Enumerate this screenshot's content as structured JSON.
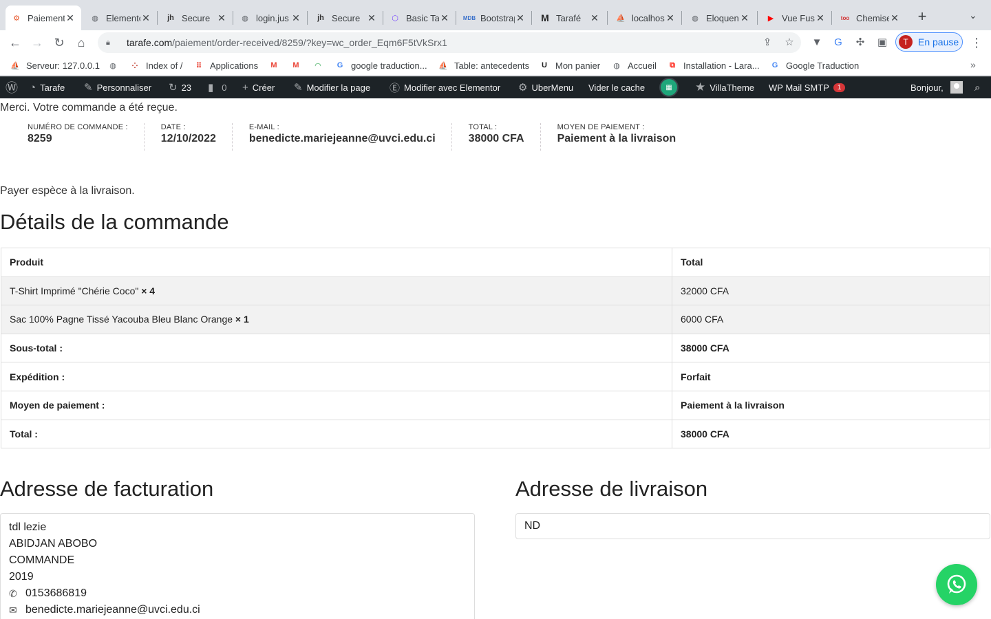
{
  "browser": {
    "tabs": [
      {
        "title": "Paiement",
        "favicon": "woocommerce-icon",
        "active": true
      },
      {
        "title": "Elementor",
        "favicon": "globe-icon",
        "active": false
      },
      {
        "title": "Secure",
        "favicon": "jh-icon",
        "active": false
      },
      {
        "title": "login.jus",
        "favicon": "globe-icon",
        "active": false
      },
      {
        "title": "Secure",
        "favicon": "jh-icon",
        "active": false
      },
      {
        "title": "Basic Ta",
        "favicon": "hexagon-icon",
        "active": false
      },
      {
        "title": "Bootstrap",
        "favicon": "mdb-icon",
        "active": false
      },
      {
        "title": "Tarafé",
        "favicon": "m-icon",
        "active": false
      },
      {
        "title": "localhost",
        "favicon": "pma-icon",
        "active": false
      },
      {
        "title": "Eloquent",
        "favicon": "globe-icon",
        "active": false
      },
      {
        "title": "Vue Fus",
        "favicon": "youtube-icon",
        "active": false
      },
      {
        "title": "Chemise",
        "favicon": "afritoo-icon",
        "active": false
      }
    ],
    "url_host": "tarafe.com",
    "url_path": "/paiement/order-received/8259/?key=wc_order_Eqm6F5tVkSrx1",
    "profile_initial": "T",
    "profile_label": "En pause"
  },
  "bookmarks": [
    {
      "label": "Serveur: 127.0.0.1",
      "icon": "pma-icon"
    },
    {
      "label": "",
      "icon": "globe-icon"
    },
    {
      "label": "Index of /",
      "icon": "dots-icon"
    },
    {
      "label": "Applications",
      "icon": "apps-grid-icon"
    },
    {
      "label": "",
      "icon": "gmail-icon"
    },
    {
      "label": "",
      "icon": "gmail-icon"
    },
    {
      "label": "",
      "icon": "rainbow-icon"
    },
    {
      "label": "google traduction...",
      "icon": "google-icon"
    },
    {
      "label": "Table: antecedents",
      "icon": "pma-icon"
    },
    {
      "label": "Mon panier",
      "icon": "u-icon"
    },
    {
      "label": "Accueil",
      "icon": "globe-icon"
    },
    {
      "label": "Installation - Lara...",
      "icon": "laravel-icon"
    },
    {
      "label": "Google Traduction",
      "icon": "google-translate-icon"
    }
  ],
  "adminbar": {
    "site": "Tarafe",
    "customize": "Personnaliser",
    "updates": "23",
    "comments": "0",
    "create": "Créer",
    "edit_page": "Modifier la page",
    "elementor": "Modifier avec Elementor",
    "ubermenu": "UberMenu",
    "cache": "Vider le cache",
    "villatheme": "VillaTheme",
    "smtp": "WP Mail SMTP",
    "smtp_count": "1",
    "greeting": "Bonjour,"
  },
  "order": {
    "thankyou": "Merci. Votre commande a été reçue.",
    "overview": [
      {
        "label": "Numéro de commande :",
        "value": "8259"
      },
      {
        "label": "Date :",
        "value": "12/10/2022"
      },
      {
        "label": "E-mail :",
        "value": "benedicte.mariejeanne@uvci.edu.ci"
      },
      {
        "label": "Total :",
        "value": "38000 CFA"
      },
      {
        "label": "Moyen de paiement :",
        "value": "Paiement à la livraison"
      }
    ],
    "payment_note": "Payer espèce à la livraison.",
    "details_title": "Détails de la commande",
    "table_headers": {
      "product": "Produit",
      "total": "Total"
    },
    "items": [
      {
        "name": "T-Shirt Imprimé \"Chérie Coco\"",
        "qty": "× 4",
        "total": "32000 CFA"
      },
      {
        "name": "Sac 100% Pagne Tissé Yacouba Bleu Blanc Orange",
        "qty": "× 1",
        "total": "6000 CFA"
      }
    ],
    "totals": [
      {
        "label": "Sous-total :",
        "value": "38000 CFA"
      },
      {
        "label": "Expédition :",
        "value": "Forfait"
      },
      {
        "label": "Moyen de paiement :",
        "value": "Paiement à la livraison"
      },
      {
        "label": "Total :",
        "value": "38000 CFA"
      }
    ]
  },
  "billing": {
    "title": "Adresse de facturation",
    "lines": [
      "tdl lezie",
      "ABIDJAN ABOBO",
      "COMMANDE",
      "2019"
    ],
    "phone": "0153686819",
    "email": "benedicte.mariejeanne@uvci.edu.ci"
  },
  "shipping": {
    "title": "Adresse de livraison",
    "value": "ND"
  },
  "colors": {
    "adminbar": "#1d2327",
    "whatsapp": "#25d366",
    "badge": "#d63638"
  }
}
